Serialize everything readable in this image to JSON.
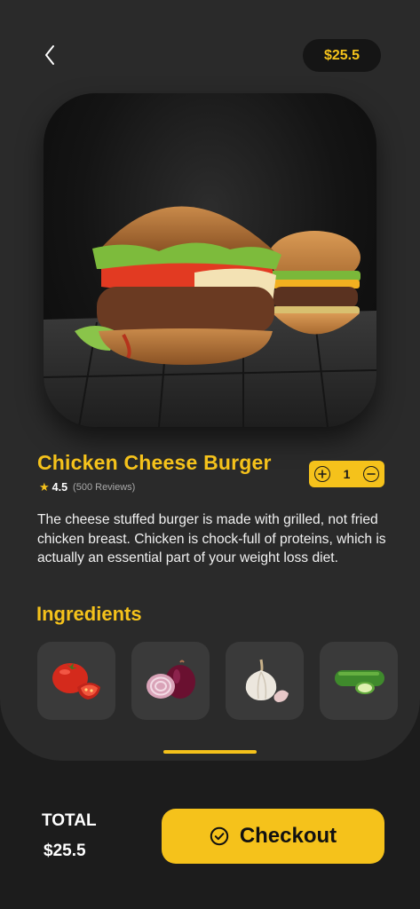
{
  "header": {
    "price": "$25.5"
  },
  "product": {
    "name": "Chicken Cheese Burger",
    "rating": "4.5",
    "reviews": "(500 Reviews)",
    "quantity": "1",
    "description": "The cheese stuffed burger is made with grilled, not fried chicken breast. Chicken is chock-full of proteins, which is actually an essential part of your weight loss diet."
  },
  "ingredients": {
    "title": "Ingredients",
    "items": [
      {
        "icon": "tomato-icon"
      },
      {
        "icon": "onion-icon"
      },
      {
        "icon": "garlic-icon"
      },
      {
        "icon": "zucchini-icon"
      }
    ]
  },
  "footer": {
    "total_label": "TOTAL",
    "total_value": "$25.5",
    "checkout_label": "Checkout"
  },
  "colors": {
    "accent": "#f5c21b",
    "background": "#1c1c1c",
    "card": "#2a2a2a",
    "tile": "#3a3a3a"
  }
}
